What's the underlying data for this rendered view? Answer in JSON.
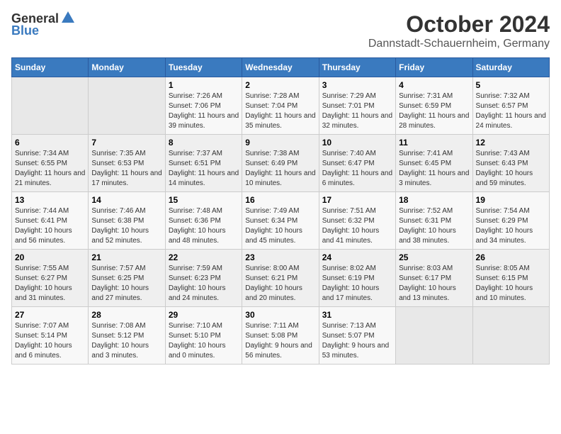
{
  "header": {
    "logo_general": "General",
    "logo_blue": "Blue",
    "month": "October 2024",
    "location": "Dannstadt-Schauernheim, Germany"
  },
  "weekdays": [
    "Sunday",
    "Monday",
    "Tuesday",
    "Wednesday",
    "Thursday",
    "Friday",
    "Saturday"
  ],
  "weeks": [
    [
      {
        "day": "",
        "sunrise": "",
        "sunset": "",
        "daylight": ""
      },
      {
        "day": "",
        "sunrise": "",
        "sunset": "",
        "daylight": ""
      },
      {
        "day": "1",
        "sunrise": "Sunrise: 7:26 AM",
        "sunset": "Sunset: 7:06 PM",
        "daylight": "Daylight: 11 hours and 39 minutes."
      },
      {
        "day": "2",
        "sunrise": "Sunrise: 7:28 AM",
        "sunset": "Sunset: 7:04 PM",
        "daylight": "Daylight: 11 hours and 35 minutes."
      },
      {
        "day": "3",
        "sunrise": "Sunrise: 7:29 AM",
        "sunset": "Sunset: 7:01 PM",
        "daylight": "Daylight: 11 hours and 32 minutes."
      },
      {
        "day": "4",
        "sunrise": "Sunrise: 7:31 AM",
        "sunset": "Sunset: 6:59 PM",
        "daylight": "Daylight: 11 hours and 28 minutes."
      },
      {
        "day": "5",
        "sunrise": "Sunrise: 7:32 AM",
        "sunset": "Sunset: 6:57 PM",
        "daylight": "Daylight: 11 hours and 24 minutes."
      }
    ],
    [
      {
        "day": "6",
        "sunrise": "Sunrise: 7:34 AM",
        "sunset": "Sunset: 6:55 PM",
        "daylight": "Daylight: 11 hours and 21 minutes."
      },
      {
        "day": "7",
        "sunrise": "Sunrise: 7:35 AM",
        "sunset": "Sunset: 6:53 PM",
        "daylight": "Daylight: 11 hours and 17 minutes."
      },
      {
        "day": "8",
        "sunrise": "Sunrise: 7:37 AM",
        "sunset": "Sunset: 6:51 PM",
        "daylight": "Daylight: 11 hours and 14 minutes."
      },
      {
        "day": "9",
        "sunrise": "Sunrise: 7:38 AM",
        "sunset": "Sunset: 6:49 PM",
        "daylight": "Daylight: 11 hours and 10 minutes."
      },
      {
        "day": "10",
        "sunrise": "Sunrise: 7:40 AM",
        "sunset": "Sunset: 6:47 PM",
        "daylight": "Daylight: 11 hours and 6 minutes."
      },
      {
        "day": "11",
        "sunrise": "Sunrise: 7:41 AM",
        "sunset": "Sunset: 6:45 PM",
        "daylight": "Daylight: 11 hours and 3 minutes."
      },
      {
        "day": "12",
        "sunrise": "Sunrise: 7:43 AM",
        "sunset": "Sunset: 6:43 PM",
        "daylight": "Daylight: 10 hours and 59 minutes."
      }
    ],
    [
      {
        "day": "13",
        "sunrise": "Sunrise: 7:44 AM",
        "sunset": "Sunset: 6:41 PM",
        "daylight": "Daylight: 10 hours and 56 minutes."
      },
      {
        "day": "14",
        "sunrise": "Sunrise: 7:46 AM",
        "sunset": "Sunset: 6:38 PM",
        "daylight": "Daylight: 10 hours and 52 minutes."
      },
      {
        "day": "15",
        "sunrise": "Sunrise: 7:48 AM",
        "sunset": "Sunset: 6:36 PM",
        "daylight": "Daylight: 10 hours and 48 minutes."
      },
      {
        "day": "16",
        "sunrise": "Sunrise: 7:49 AM",
        "sunset": "Sunset: 6:34 PM",
        "daylight": "Daylight: 10 hours and 45 minutes."
      },
      {
        "day": "17",
        "sunrise": "Sunrise: 7:51 AM",
        "sunset": "Sunset: 6:32 PM",
        "daylight": "Daylight: 10 hours and 41 minutes."
      },
      {
        "day": "18",
        "sunrise": "Sunrise: 7:52 AM",
        "sunset": "Sunset: 6:31 PM",
        "daylight": "Daylight: 10 hours and 38 minutes."
      },
      {
        "day": "19",
        "sunrise": "Sunrise: 7:54 AM",
        "sunset": "Sunset: 6:29 PM",
        "daylight": "Daylight: 10 hours and 34 minutes."
      }
    ],
    [
      {
        "day": "20",
        "sunrise": "Sunrise: 7:55 AM",
        "sunset": "Sunset: 6:27 PM",
        "daylight": "Daylight: 10 hours and 31 minutes."
      },
      {
        "day": "21",
        "sunrise": "Sunrise: 7:57 AM",
        "sunset": "Sunset: 6:25 PM",
        "daylight": "Daylight: 10 hours and 27 minutes."
      },
      {
        "day": "22",
        "sunrise": "Sunrise: 7:59 AM",
        "sunset": "Sunset: 6:23 PM",
        "daylight": "Daylight: 10 hours and 24 minutes."
      },
      {
        "day": "23",
        "sunrise": "Sunrise: 8:00 AM",
        "sunset": "Sunset: 6:21 PM",
        "daylight": "Daylight: 10 hours and 20 minutes."
      },
      {
        "day": "24",
        "sunrise": "Sunrise: 8:02 AM",
        "sunset": "Sunset: 6:19 PM",
        "daylight": "Daylight: 10 hours and 17 minutes."
      },
      {
        "day": "25",
        "sunrise": "Sunrise: 8:03 AM",
        "sunset": "Sunset: 6:17 PM",
        "daylight": "Daylight: 10 hours and 13 minutes."
      },
      {
        "day": "26",
        "sunrise": "Sunrise: 8:05 AM",
        "sunset": "Sunset: 6:15 PM",
        "daylight": "Daylight: 10 hours and 10 minutes."
      }
    ],
    [
      {
        "day": "27",
        "sunrise": "Sunrise: 7:07 AM",
        "sunset": "Sunset: 5:14 PM",
        "daylight": "Daylight: 10 hours and 6 minutes."
      },
      {
        "day": "28",
        "sunrise": "Sunrise: 7:08 AM",
        "sunset": "Sunset: 5:12 PM",
        "daylight": "Daylight: 10 hours and 3 minutes."
      },
      {
        "day": "29",
        "sunrise": "Sunrise: 7:10 AM",
        "sunset": "Sunset: 5:10 PM",
        "daylight": "Daylight: 10 hours and 0 minutes."
      },
      {
        "day": "30",
        "sunrise": "Sunrise: 7:11 AM",
        "sunset": "Sunset: 5:08 PM",
        "daylight": "Daylight: 9 hours and 56 minutes."
      },
      {
        "day": "31",
        "sunrise": "Sunrise: 7:13 AM",
        "sunset": "Sunset: 5:07 PM",
        "daylight": "Daylight: 9 hours and 53 minutes."
      },
      {
        "day": "",
        "sunrise": "",
        "sunset": "",
        "daylight": ""
      },
      {
        "day": "",
        "sunrise": "",
        "sunset": "",
        "daylight": ""
      }
    ]
  ]
}
